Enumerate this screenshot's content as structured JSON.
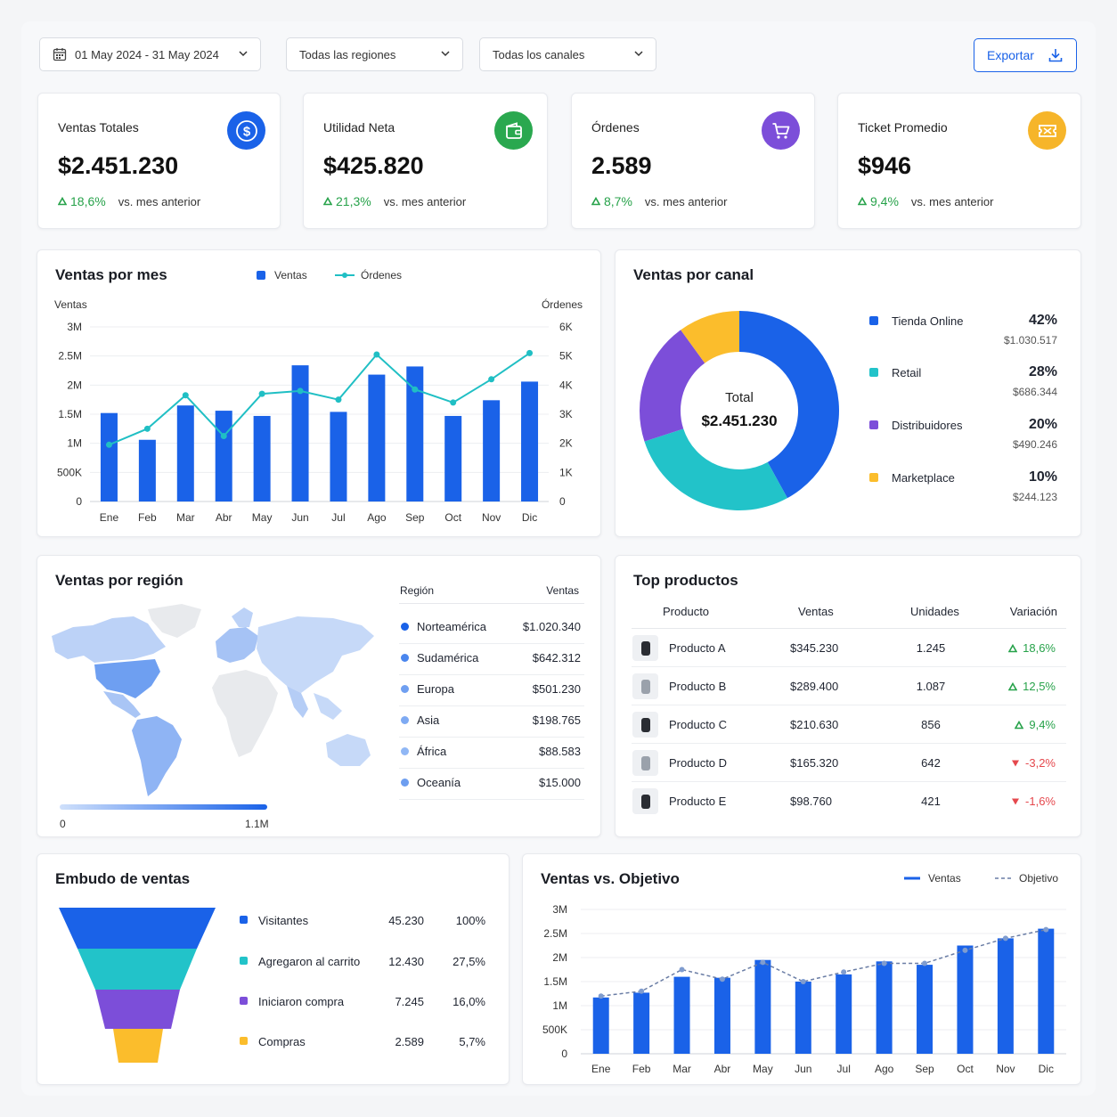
{
  "filters": {
    "date_range": "01 May 2024 - 31 May 2024",
    "region": "Todas las regiones",
    "channel": "Todas los canales",
    "export_label": "Exportar"
  },
  "kpis": [
    {
      "label": "Ventas Totales",
      "value": "$2.451.230",
      "change": "18,6%",
      "vs": "vs. mes anterior",
      "icon": "dollar-icon",
      "color": "#1a62e8"
    },
    {
      "label": "Utilidad Neta",
      "value": "$425.820",
      "change": "21,3%",
      "vs": "vs. mes anterior",
      "icon": "wallet-icon",
      "color": "#2aa84f"
    },
    {
      "label": "Órdenes",
      "value": "2.589",
      "change": "8,7%",
      "vs": "vs. mes anterior",
      "icon": "cart-icon",
      "color": "#7c4ed9"
    },
    {
      "label": "Ticket Promedio",
      "value": "$946",
      "change": "9,4%",
      "vs": "vs. mes anterior",
      "icon": "ticket-icon",
      "color": "#f6b52a"
    }
  ],
  "monthly": {
    "title": "Ventas por mes",
    "legend_bars": "Ventas",
    "legend_line": "Órdenes",
    "left_axis_label": "Ventas",
    "right_axis_label": "Órdenes",
    "left_ticks": [
      "0",
      "500K",
      "1M",
      "1.5M",
      "2M",
      "2.5M",
      "3M"
    ],
    "right_ticks": [
      "0",
      "1K",
      "2K",
      "3K",
      "4K",
      "5K",
      "6K"
    ]
  },
  "channels": {
    "title": "Ventas por canal",
    "total_label": "Total",
    "total_value": "$2.451.230",
    "items": [
      {
        "name": "Tienda Online",
        "pct": "42%",
        "amount": "$1.030.517",
        "color": "#1a62e8",
        "share": 42
      },
      {
        "name": "Retail",
        "pct": "28%",
        "amount": "$686.344",
        "color": "#22c3c9",
        "share": 28
      },
      {
        "name": "Distribuidores",
        "pct": "20%",
        "amount": "$490.246",
        "color": "#7c4ed9",
        "share": 20
      },
      {
        "name": "Marketplace",
        "pct": "10%",
        "amount": "$244.123",
        "color": "#fbbd2c",
        "share": 10
      }
    ]
  },
  "regions": {
    "title": "Ventas por región",
    "col_region": "Región",
    "col_sales": "Ventas",
    "scale_min": "0",
    "scale_max": "1.1M",
    "rows": [
      {
        "name": "Norteamérica",
        "value": "$1.020.340",
        "color": "#1a62e8"
      },
      {
        "name": "Sudamérica",
        "value": "$642.312",
        "color": "#4a86ee"
      },
      {
        "name": "Europa",
        "value": "$501.230",
        "color": "#6f9ff1"
      },
      {
        "name": "Asia",
        "value": "$198.765",
        "color": "#7eaaf3"
      },
      {
        "name": "África",
        "value": "$88.583",
        "color": "#90b7f5"
      },
      {
        "name": "Oceanía",
        "value": "$15.000",
        "color": "#6d9ef0"
      }
    ]
  },
  "products": {
    "title": "Top productos",
    "headers": [
      "Producto",
      "Ventas",
      "Unidades",
      "Variación"
    ],
    "rows": [
      {
        "name": "Producto A",
        "sales": "$345.230",
        "units": "1.245",
        "change": "18,6%",
        "up": true
      },
      {
        "name": "Producto B",
        "sales": "$289.400",
        "units": "1.087",
        "change": "12,5%",
        "up": true
      },
      {
        "name": "Producto C",
        "sales": "$210.630",
        "units": "856",
        "change": "9,4%",
        "up": true
      },
      {
        "name": "Producto D",
        "sales": "$165.320",
        "units": "642",
        "change": "-3,2%",
        "up": false
      },
      {
        "name": "Producto E",
        "sales": "$98.760",
        "units": "421",
        "change": "-1,6%",
        "up": false
      }
    ]
  },
  "funnel": {
    "title": "Embudo de ventas",
    "rows": [
      {
        "name": "Visitantes",
        "value": "45.230",
        "pct": "100%",
        "color": "#1a62e8"
      },
      {
        "name": "Agregaron al carrito",
        "value": "12.430",
        "pct": "27,5%",
        "color": "#22c3c9"
      },
      {
        "name": "Iniciaron compra",
        "value": "7.245",
        "pct": "16,0%",
        "color": "#7c4ed9"
      },
      {
        "name": "Compras",
        "value": "2.589",
        "pct": "5,7%",
        "color": "#fbbd2c"
      }
    ]
  },
  "target": {
    "title": "Ventas vs. Objetivo",
    "legend_sales": "Ventas",
    "legend_target": "Objetivo",
    "ticks": [
      "0",
      "500K",
      "1M",
      "1.5M",
      "2M",
      "2.5M",
      "3M"
    ]
  },
  "chart_data": [
    {
      "type": "bar",
      "title": "Ventas por mes",
      "categories": [
        "Ene",
        "Feb",
        "Mar",
        "Abr",
        "May",
        "Jun",
        "Jul",
        "Ago",
        "Sep",
        "Oct",
        "Nov",
        "Dic"
      ],
      "ylabel": "Ventas",
      "y2label": "Órdenes",
      "ylim": [
        0,
        3000000
      ],
      "y2lim": [
        0,
        6000
      ],
      "series": [
        {
          "name": "Ventas",
          "type": "bar",
          "values": [
            1520000,
            1060000,
            1650000,
            1560000,
            1470000,
            2340000,
            1540000,
            2180000,
            2320000,
            1470000,
            1740000,
            2060000
          ]
        },
        {
          "name": "Órdenes",
          "type": "line",
          "values": [
            1950,
            2500,
            3650,
            2250,
            3700,
            3800,
            3500,
            5050,
            3850,
            3400,
            4200,
            5100
          ]
        }
      ],
      "legend": "top"
    },
    {
      "type": "pie",
      "title": "Ventas por canal",
      "categories": [
        "Tienda Online",
        "Retail",
        "Distribuidores",
        "Marketplace"
      ],
      "values": [
        42,
        28,
        20,
        10
      ]
    },
    {
      "type": "bar",
      "title": "Ventas vs. Objetivo",
      "categories": [
        "Ene",
        "Feb",
        "Mar",
        "Abr",
        "May",
        "Jun",
        "Jul",
        "Ago",
        "Sep",
        "Oct",
        "Nov",
        "Dic"
      ],
      "ylim": [
        0,
        3000000
      ],
      "series": [
        {
          "name": "Ventas",
          "type": "bar",
          "values": [
            1170000,
            1270000,
            1600000,
            1580000,
            1950000,
            1500000,
            1650000,
            1920000,
            1850000,
            2250000,
            2400000,
            2600000
          ]
        },
        {
          "name": "Objetivo",
          "type": "line",
          "values": [
            1200000,
            1300000,
            1750000,
            1550000,
            1900000,
            1500000,
            1700000,
            1880000,
            1880000,
            2150000,
            2400000,
            2580000
          ]
        }
      ],
      "legend": "top-right"
    }
  ]
}
